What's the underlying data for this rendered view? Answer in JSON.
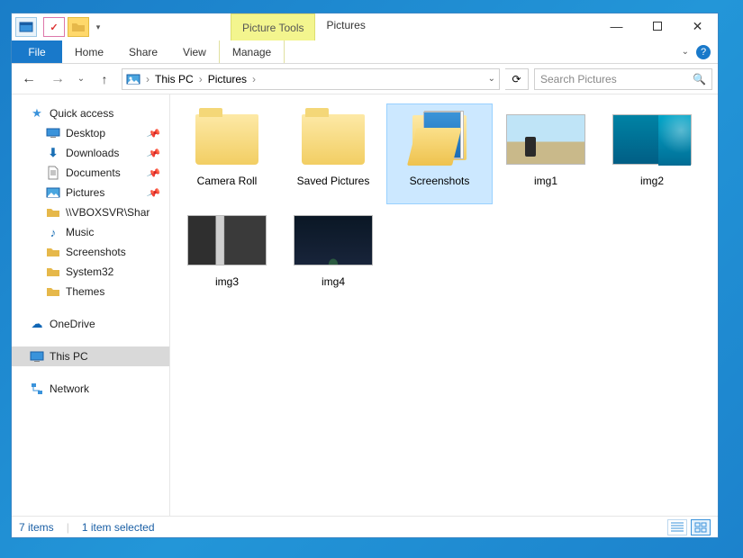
{
  "window": {
    "title": "Pictures",
    "contextual_tab": "Picture Tools"
  },
  "ribbon": {
    "file": "File",
    "tabs": [
      "Home",
      "Share",
      "View",
      "Manage"
    ]
  },
  "breadcrumb": {
    "seg1": "This PC",
    "seg2": "Pictures"
  },
  "search": {
    "placeholder": "Search Pictures"
  },
  "nav": {
    "quick_access": "Quick access",
    "quick_children": [
      {
        "label": "Desktop",
        "icon": "desktop"
      },
      {
        "label": "Downloads",
        "icon": "downloads"
      },
      {
        "label": "Documents",
        "icon": "documents"
      },
      {
        "label": "Pictures",
        "icon": "pictures"
      },
      {
        "label": "\\\\VBOXSVR\\Shar",
        "icon": "netfolder"
      },
      {
        "label": "Music",
        "icon": "music"
      },
      {
        "label": "Screenshots",
        "icon": "folder"
      },
      {
        "label": "System32",
        "icon": "folder"
      },
      {
        "label": "Themes",
        "icon": "folder"
      }
    ],
    "onedrive": "OneDrive",
    "this_pc": "This PC",
    "network": "Network"
  },
  "items": [
    {
      "name": "Camera Roll",
      "type": "folder"
    },
    {
      "name": "Saved Pictures",
      "type": "folder"
    },
    {
      "name": "Screenshots",
      "type": "folder-open",
      "selected": true
    },
    {
      "name": "img1",
      "type": "img1"
    },
    {
      "name": "img2",
      "type": "img2"
    },
    {
      "name": "img3",
      "type": "img3"
    },
    {
      "name": "img4",
      "type": "img4"
    }
  ],
  "status": {
    "count": "7 items",
    "selection": "1 item selected"
  }
}
